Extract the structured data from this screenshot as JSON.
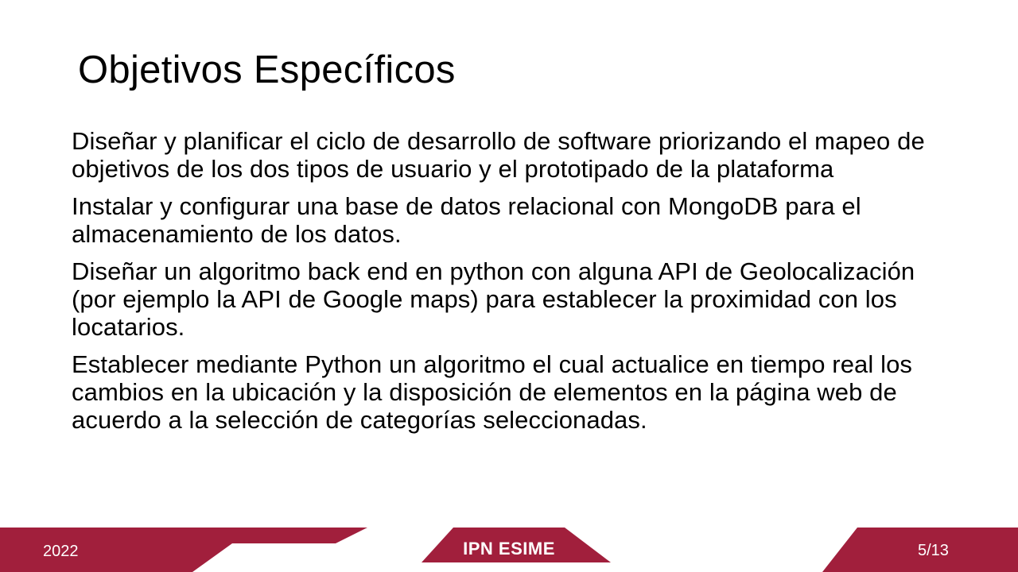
{
  "slide": {
    "title": "Objetivos Específicos",
    "objectives": [
      "Diseñar y planificar el ciclo de desarrollo de software priorizando el mapeo de objetivos de los dos tipos de usuario y el prototipado de la plataforma",
      "Instalar y configurar una base de datos relacional con MongoDB para el almacenamiento de los datos.",
      "Diseñar un algoritmo back end en python con alguna API de Geolocalización (por ejemplo la API de Google maps) para establecer la proximidad con los locatarios.",
      "Establecer mediante Python un algoritmo el cual actualice en tiempo real los cambios en la ubicación y la disposición de elementos en la página web de acuerdo a la selección de categorías seleccionadas."
    ]
  },
  "footer": {
    "year": "2022",
    "brand": "IPN ESIME",
    "page_number": "5/13",
    "accent_color": "#a11f3c"
  }
}
